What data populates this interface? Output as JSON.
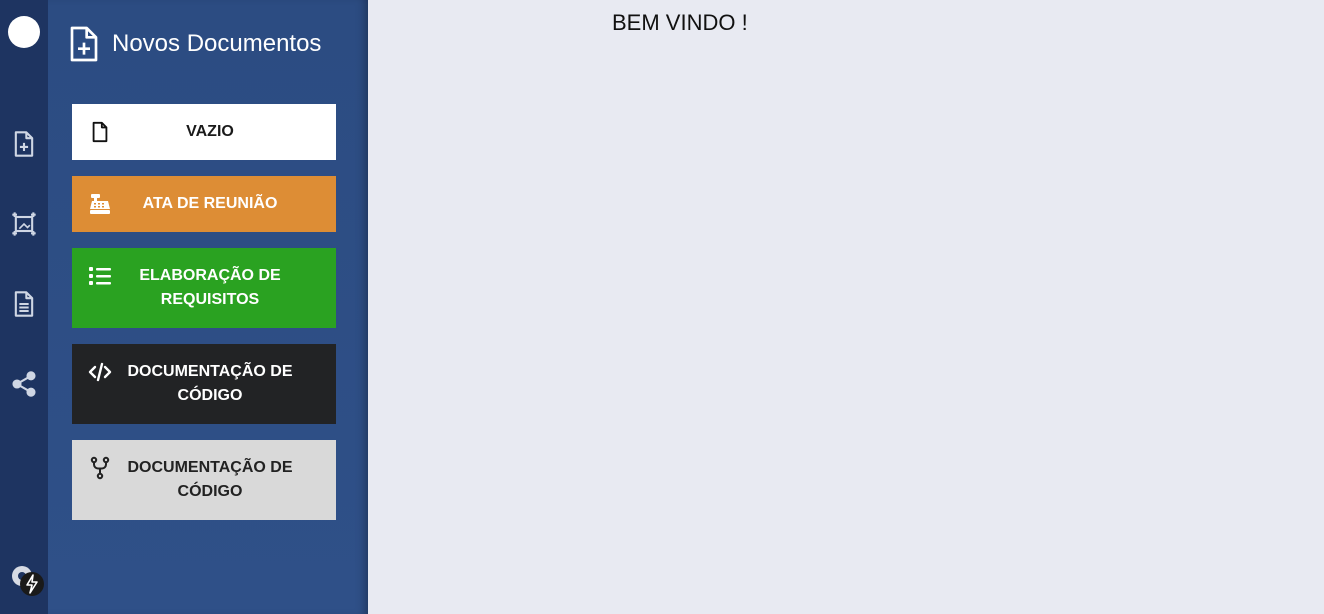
{
  "rail": {
    "items": [
      {
        "name": "new-document-icon"
      },
      {
        "name": "frame-icon"
      },
      {
        "name": "document-lines-icon"
      },
      {
        "name": "share-icon"
      }
    ],
    "settings_icon": "gear-icon",
    "badge_icon": "lightning-icon"
  },
  "panel": {
    "title": "Novos Documentos",
    "title_icon": "file-plus-icon",
    "buttons": [
      {
        "label": "VAZIO",
        "icon": "file-icon",
        "color": "#ffffff"
      },
      {
        "label": "ATA DE REUNIÃO",
        "icon": "cash-register-icon",
        "color": "#dd8d35"
      },
      {
        "label": "ELABORAÇÃO DE REQUISITOS",
        "icon": "list-icon",
        "color": "#2aa221"
      },
      {
        "label": "DOCUMENTAÇÃO DE CÓDIGO",
        "icon": "code-icon",
        "color": "#222325"
      },
      {
        "label": "DOCUMENTAÇÃO DE CÓDIGO",
        "icon": "fork-icon",
        "color": "#d9d9d9"
      }
    ]
  },
  "main": {
    "welcome": "BEM VINDO !"
  }
}
